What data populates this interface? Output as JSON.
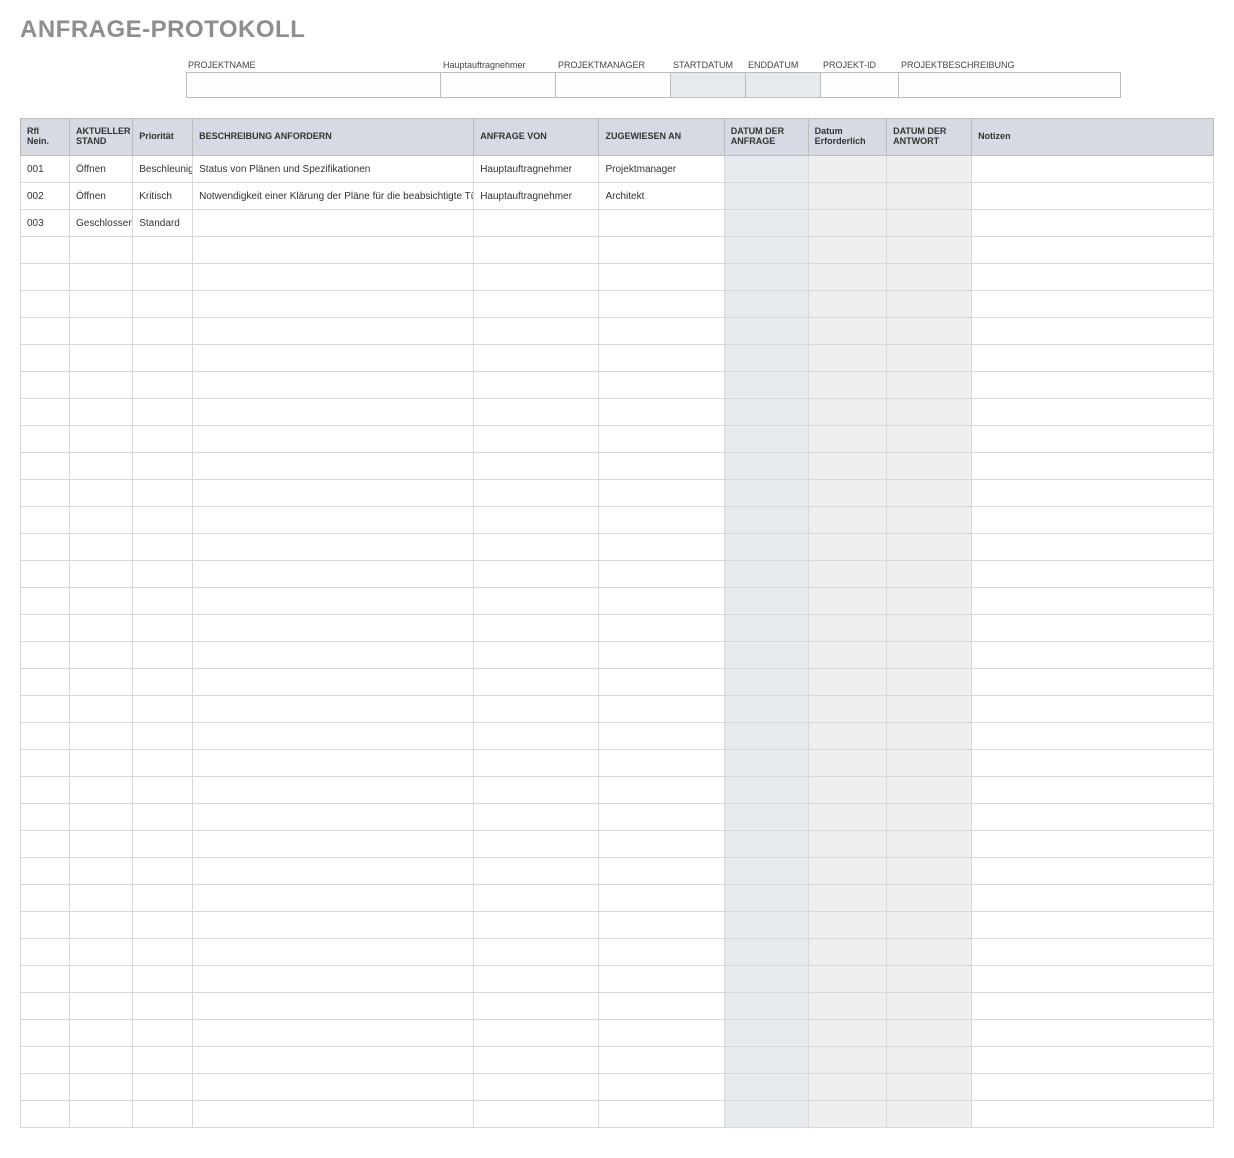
{
  "title": "ANFRAGE-PROTOKOLL",
  "meta": {
    "labels": {
      "project_name": "PROJEKTNAME",
      "contractor": "Hauptauftragnehmer",
      "project_manager": "PROJEKTMANAGER",
      "start_date": "STARTDATUM",
      "end_date": "ENDDATUM",
      "project_id": "PROJEKT-ID",
      "project_desc": "PROJEKTBESCHREIBUNG"
    },
    "values": {
      "project_name": "",
      "contractor": "",
      "project_manager": "",
      "start_date": "",
      "end_date": "",
      "project_id": "",
      "project_desc": ""
    }
  },
  "table": {
    "headers": {
      "id": "RfI\nNein.",
      "status": "AKTUELLER STAND",
      "priority": "Priorität",
      "description": "BESCHREIBUNG ANFORDERN",
      "from": "ANFRAGE VON",
      "to": "ZUGEWIESEN AN",
      "date_req": "DATUM DER ANFRAGE",
      "date_due": "Datum Erforderlich",
      "date_resp": "DATUM DER ANTWORT",
      "notes": "Notizen"
    },
    "rows": [
      {
        "id": "001",
        "status": "Öffnen",
        "priority": "Beschleunigt",
        "description": "Status von Plänen und Spezifikationen",
        "from": "Hauptauftragnehmer",
        "to": "Projektmanager",
        "date_req": "",
        "date_due": "",
        "date_resp": "",
        "notes": ""
      },
      {
        "id": "002",
        "status": "Öffnen",
        "priority": "Kritisch",
        "description": "Notwendigkeit einer Klärung der Pläne für die beabsichtigte Türhöhe",
        "from": "Hauptauftragnehmer",
        "to": "Architekt",
        "date_req": "",
        "date_due": "",
        "date_resp": "",
        "notes": ""
      },
      {
        "id": "003",
        "status": "Geschlossen",
        "priority": "Standard",
        "description": "",
        "from": "",
        "to": "",
        "date_req": "",
        "date_due": "",
        "date_resp": "",
        "notes": ""
      }
    ],
    "empty_row_count": 33
  }
}
